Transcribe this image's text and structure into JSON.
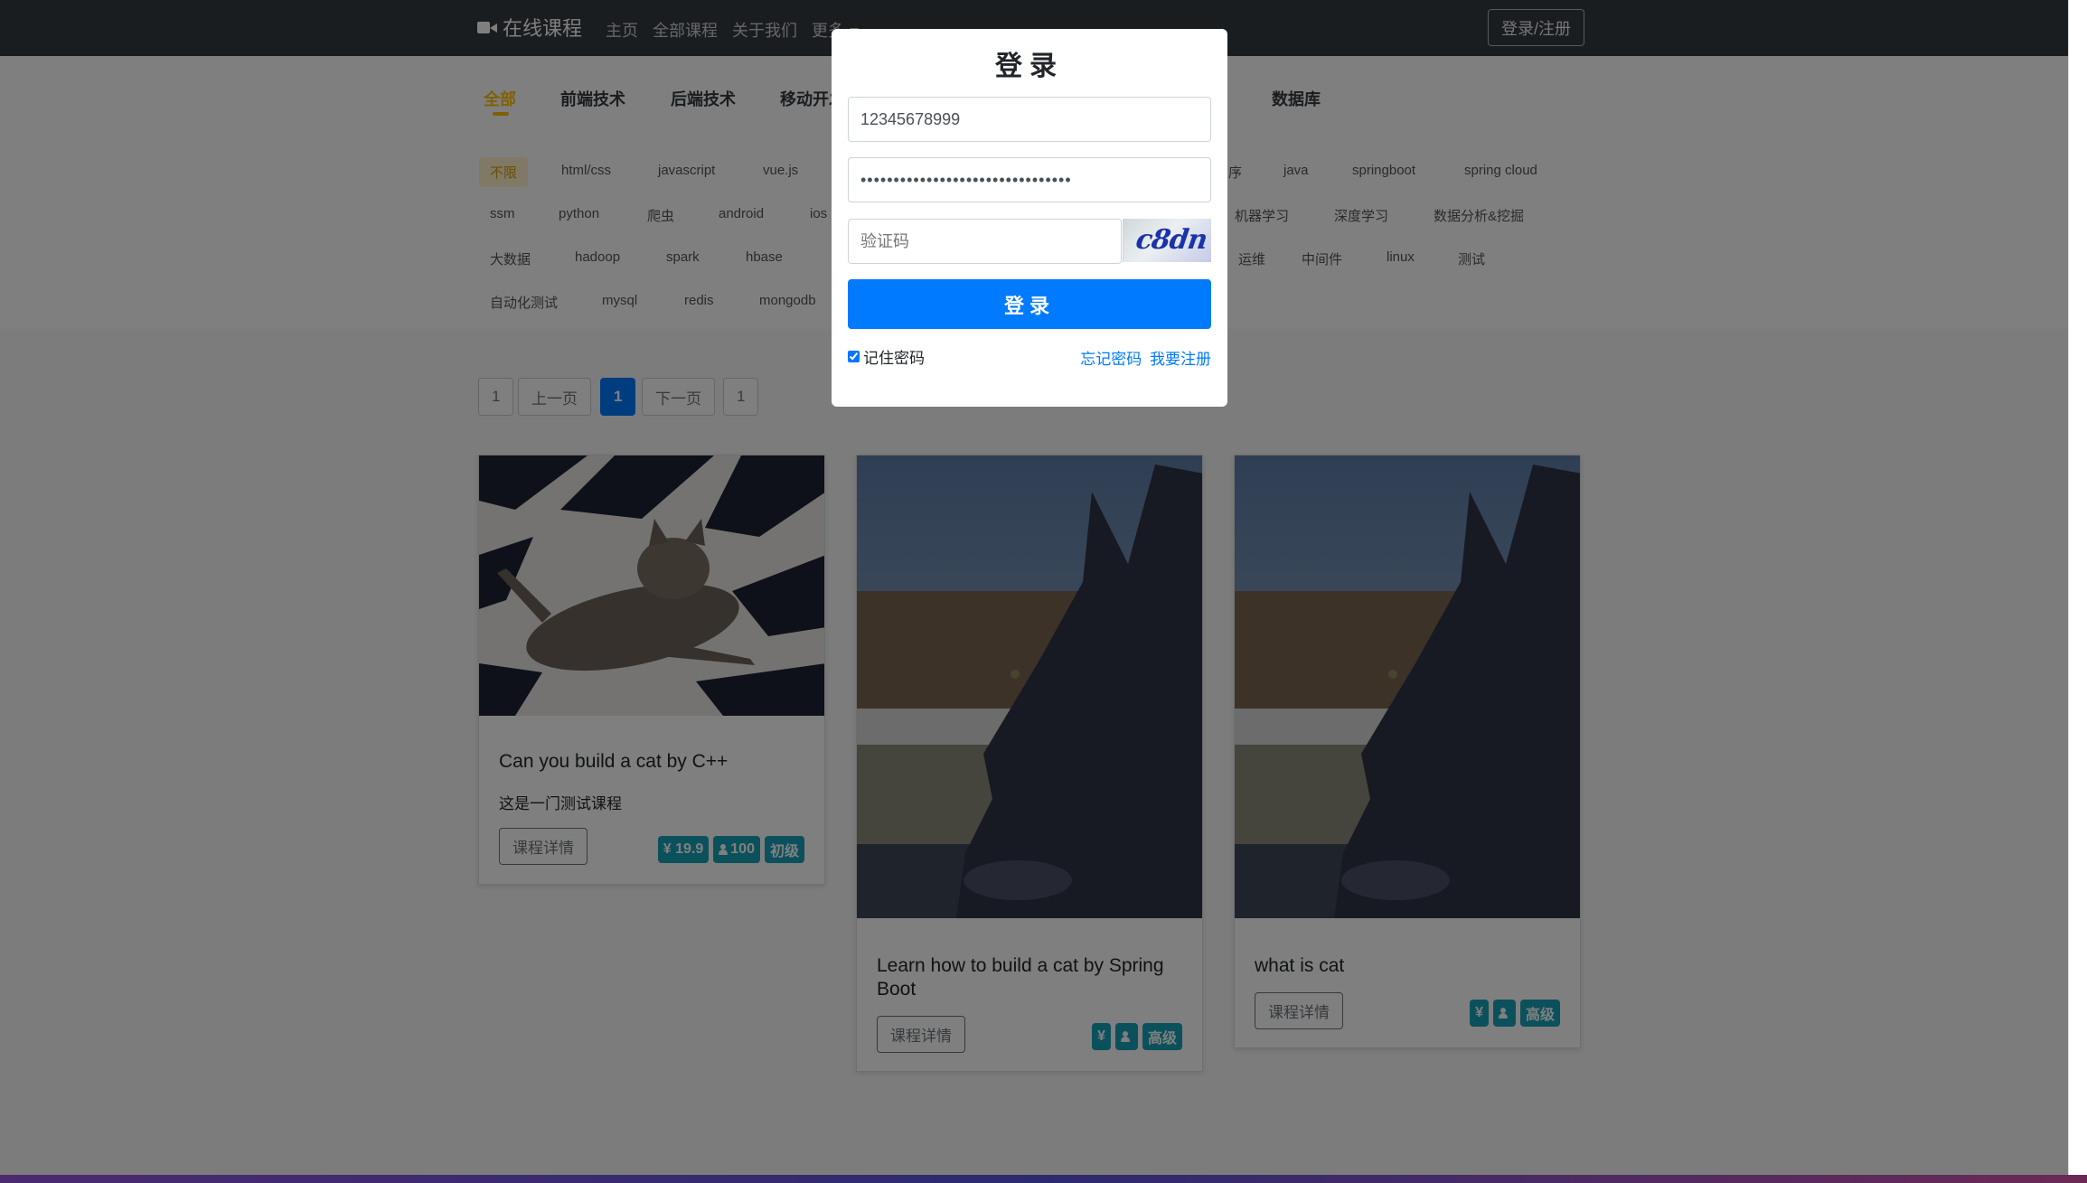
{
  "navbar": {
    "brand": "在线课程",
    "links": [
      "主页",
      "全部课程",
      "关于我们"
    ],
    "more": "更多",
    "login_register": "登录/注册"
  },
  "categories": [
    "全部",
    "前端技术",
    "后端技术",
    "移动开发",
    "数据库"
  ],
  "tags": {
    "row1": [
      "不限",
      "html/css",
      "javascript",
      "vue.js",
      "序",
      "java",
      "springboot",
      "spring cloud"
    ],
    "row2": [
      "ssm",
      "python",
      "爬虫",
      "android",
      "ios",
      "机器学习",
      "深度学习",
      "数据分析&挖掘"
    ],
    "row3": [
      "大数据",
      "hadoop",
      "spark",
      "hbase",
      "运维",
      "中间件",
      "linux",
      "测试"
    ],
    "row4": [
      "自动化测试",
      "mysql",
      "redis",
      "mongodb"
    ]
  },
  "pagination": {
    "first": "1",
    "prev": "上一页",
    "current": "1",
    "next": "下一页",
    "last": "1"
  },
  "courses": [
    {
      "title": "Can you build a cat by C++",
      "desc": "这是一门测试课程",
      "detail": "课程详情",
      "price": "¥ 19.9",
      "students": "100",
      "level": "初级"
    },
    {
      "title": "Learn how to build a cat by Spring Boot",
      "desc": "",
      "detail": "课程详情",
      "price": "¥",
      "students": "",
      "level": "高级"
    },
    {
      "title": "what is cat",
      "desc": "",
      "detail": "课程详情",
      "price": "¥",
      "students": "",
      "level": "高级"
    }
  ],
  "login_modal": {
    "title": "登录",
    "phone_value": "12345678999",
    "password_value": "••••••••••••••••••••••••••••••••",
    "captcha_placeholder": "验证码",
    "captcha_text": "c8dn",
    "submit": "登录",
    "remember": "记住密码",
    "forgot": "忘记密码",
    "register": "我要注册"
  },
  "colors": {
    "navbar": "#343a40",
    "primary": "#007bff",
    "accent": "#ffc107",
    "badge": "#17a2b8"
  }
}
